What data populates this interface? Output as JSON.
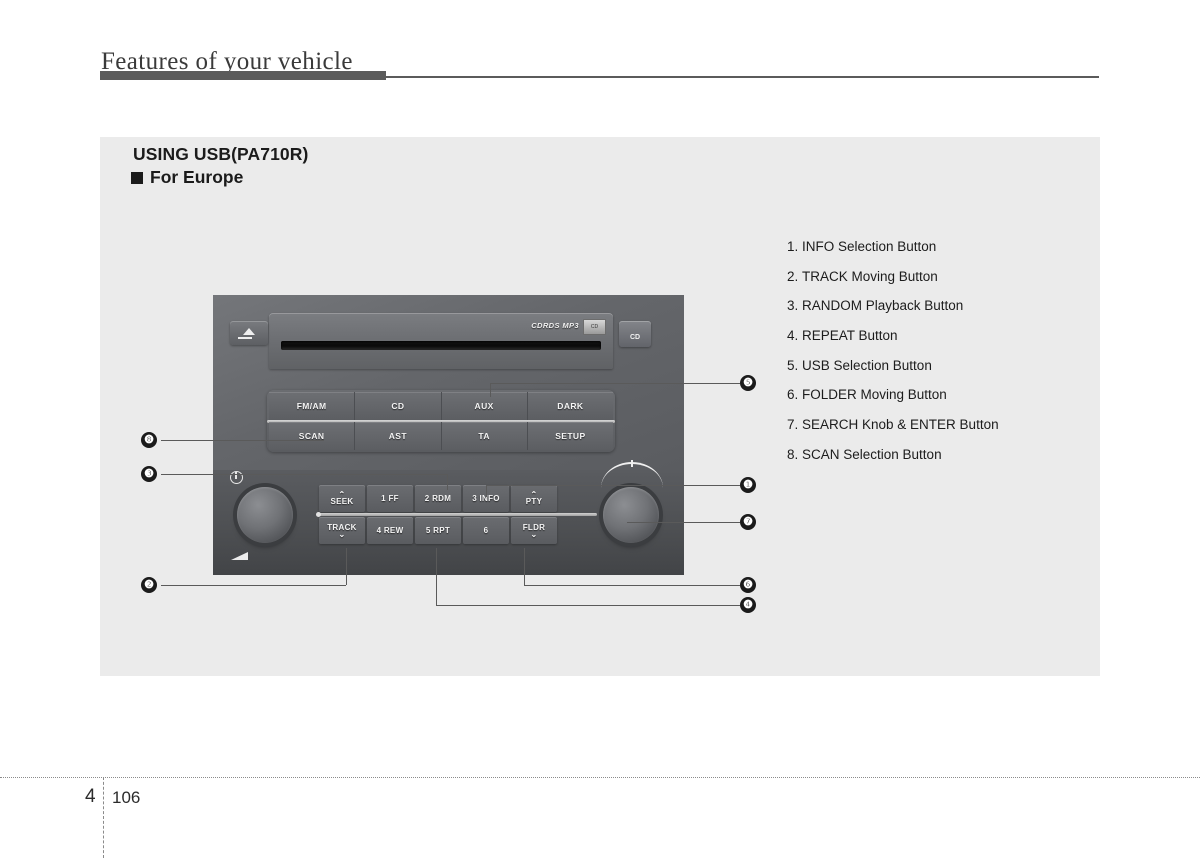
{
  "header": {
    "title": "Features of your vehicle"
  },
  "content": {
    "section_heading": "USING USB(PA710R)",
    "subsection_label": "For Europe"
  },
  "legend": {
    "items": [
      {
        "num": "1.",
        "label": "INFO Selection Button"
      },
      {
        "num": "2.",
        "label": "TRACK Moving Button"
      },
      {
        "num": "3.",
        "label": "RANDOM Playback Button"
      },
      {
        "num": "4.",
        "label": "REPEAT Button"
      },
      {
        "num": "5.",
        "label": "USB Selection Button"
      },
      {
        "num": "6.",
        "label": "FOLDER Moving Button"
      },
      {
        "num": "7.",
        "label": "SEARCH Knob & ENTER Button"
      },
      {
        "num": "8.",
        "label": "SCAN Selection Button"
      }
    ]
  },
  "radio": {
    "cd_disc_label": "CDRDS MP3",
    "cd_logo_badge": "CD",
    "cd_source_button": "CD",
    "eject_icon": "eject-icon",
    "main_buttons_top": [
      "FM/AM",
      "CD",
      "AUX",
      "DARK"
    ],
    "main_buttons_bottom": [
      "SCAN",
      "AST",
      "TA",
      "SETUP"
    ],
    "function_keys_top": [
      {
        "label": "SEEK",
        "chevron": "⌃"
      },
      {
        "label": "1  FF",
        "chevron": ""
      },
      {
        "label": "2 RDM",
        "chevron": ""
      },
      {
        "label": "3 INFO",
        "chevron": ""
      },
      {
        "label": "PTY",
        "chevron": "⌃"
      }
    ],
    "function_keys_bottom": [
      {
        "label": "TRACK",
        "chevron": "⌄"
      },
      {
        "label": "4 REW",
        "chevron": ""
      },
      {
        "label": "5 RPT",
        "chevron": ""
      },
      {
        "label": "6",
        "chevron": ""
      },
      {
        "label": "FLDR",
        "chevron": "⌄"
      }
    ],
    "left_knob_name": "power-volume-knob",
    "right_knob_name": "search-enter-knob"
  },
  "callouts": {
    "c1": "❶",
    "c2": "❷",
    "c3": "❸",
    "c4": "❹",
    "c5": "❺",
    "c6": "❻",
    "c7": "❼",
    "c8": "❽"
  },
  "footer": {
    "chapter": "4",
    "page": "106"
  }
}
